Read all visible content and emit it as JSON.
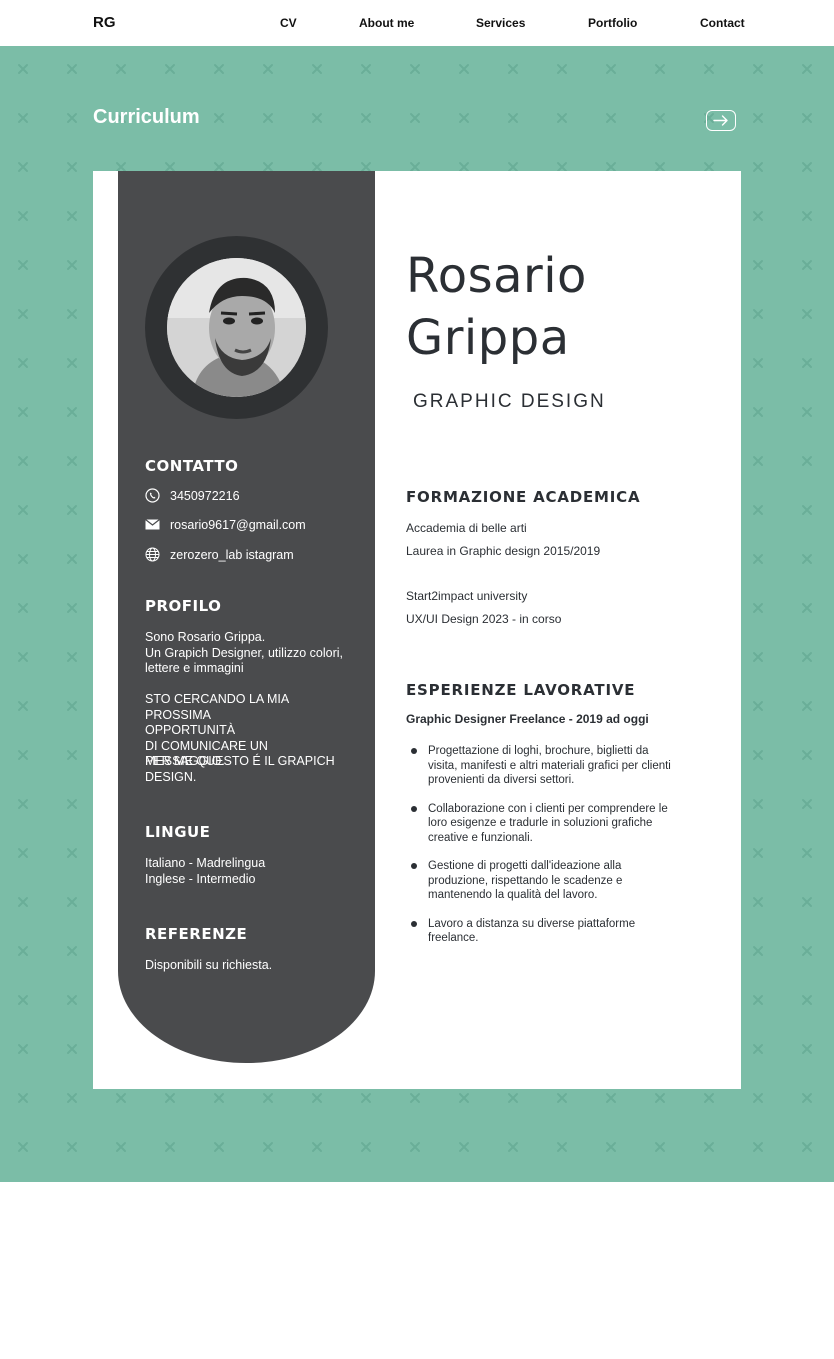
{
  "nav": {
    "logo": "RG",
    "links": [
      "CV",
      "About me",
      "Services",
      "Portfolio",
      "Contact"
    ]
  },
  "hero": {
    "title": "Curriculum",
    "arrow_icon": "arrow-right-icon",
    "background_color": "#7bbda7"
  },
  "cv": {
    "name_line1": "Rosario",
    "name_line2": "Grippa",
    "role": "GRAPHIC DESIGN",
    "sidebar_color": "#4a4b4d",
    "contact": {
      "heading": "CONTATTO",
      "phone": "3450972216",
      "email": "rosario9617@gmail.com",
      "social": "zerozero_lab istagram"
    },
    "profile": {
      "heading": "PROFILO",
      "text1": "Sono Rosario Grippa.\nUn Grapich Designer, utilizzo colori,\nlettere e immagini",
      "text2": "STO CERCANDO LA MIA PROSSIMA\nOPPORTUNITÀ\nDI COMUNICARE UN MESSAGGIO.",
      "text3": "PER ME QUESTO É IL GRAPICH\nDESIGN."
    },
    "languages": {
      "heading": "LINGUE",
      "text": "Italiano - Madrelingua\nInglese - Intermedio"
    },
    "references": {
      "heading": "REFERENZE",
      "text": "Disponibili su richiesta."
    },
    "education": {
      "heading": "FORMAZIONE ACADEMICA",
      "lines": [
        "Accademia di belle arti",
        "Laurea in Graphic design 2015/2019",
        "Start2impact university",
        "UX/UI Design 2023 - in corso"
      ]
    },
    "experience": {
      "heading": "ESPERIENZE LAVORATIVE",
      "job_title": "Graphic Designer Freelance - 2019 ad oggi",
      "bullets": [
        "Progettazione di loghi, brochure, biglietti da visita, manifesti e altri materiali grafici per clienti provenienti da diversi settori.",
        "Collaborazione con i clienti per comprendere le loro esigenze e tradurle in soluzioni grafiche creative e funzionali.",
        "Gestione di progetti dall'ideazione alla produzione, rispettando le scadenze e mantenendo la qualità del lavoro.",
        "Lavoro a distanza su diverse piattaforme freelance."
      ]
    }
  }
}
